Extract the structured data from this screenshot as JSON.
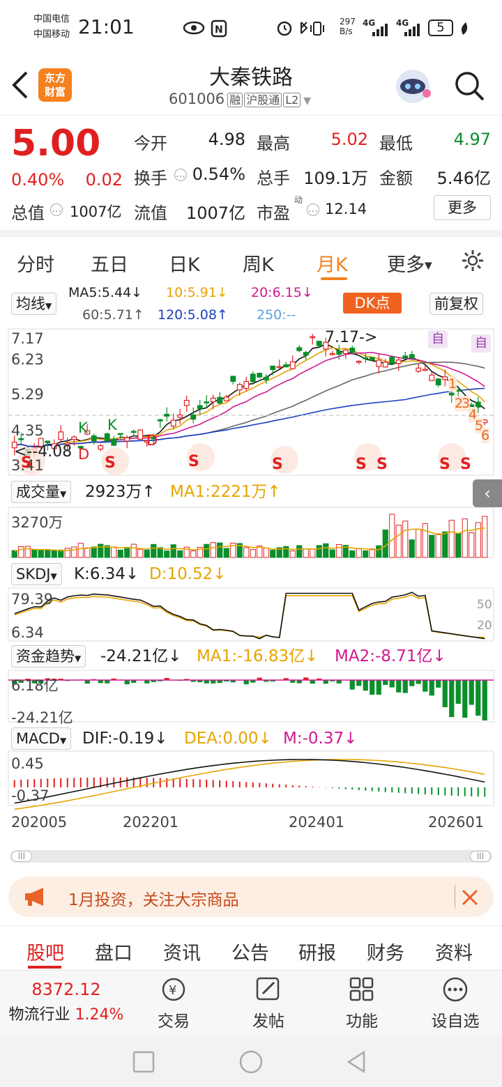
{
  "status": {
    "carrier1": "中国电信",
    "carrier2": "中国移动",
    "time": "21:01",
    "speed_top": "297",
    "speed_bot": "B/s",
    "net1": "4G",
    "net2": "4G",
    "battery": "5"
  },
  "header": {
    "logo_line1": "东方",
    "logo_line2": "财富",
    "title": "大秦铁路",
    "code": "601006",
    "tag1": "融",
    "tag2": "沪股通",
    "tag3": "L2"
  },
  "quote": {
    "price": "5.00",
    "pct": "0.40%",
    "chg": "0.02",
    "open_label": "今开",
    "open": "4.98",
    "high_label": "最高",
    "high": "5.02",
    "low_label": "最低",
    "low": "4.97",
    "turnover_label": "换手",
    "turnover": "0.54%",
    "vol_label": "总手",
    "vol": "109.1万",
    "amt_label": "金额",
    "amt": "5.46亿",
    "mcap_label": "总值",
    "mcap": "1007亿",
    "float_label": "流值",
    "float": "1007亿",
    "pe_label": "市盈",
    "pe_sup": "动",
    "pe": "12.14",
    "more": "更多"
  },
  "tabs": [
    "分时",
    "五日",
    "日K",
    "周K",
    "月K",
    "更多"
  ],
  "ma": {
    "select": "均线",
    "ma5": "MA5:5.44↓",
    "ma10": "10:5.91↓",
    "ma20": "20:6.15↓",
    "ma60": "60:5.71↑",
    "ma120": "120:5.08↑",
    "ma250": "250:--",
    "dk": "DK点",
    "fq": "前复权"
  },
  "kline": {
    "y_top": "7.17",
    "y2": "6.23",
    "y3": "5.29",
    "y4": "4.35",
    "y_bot": "3.41",
    "max_label": "7.17->",
    "min_label": "<--4.08",
    "zi1": "自",
    "zi2": "自",
    "nums": [
      "1",
      "2",
      "3",
      "4",
      "5",
      "6"
    ],
    "signals": [
      "S",
      "S",
      "S",
      "S",
      "S",
      "S",
      "S",
      "S"
    ],
    "k_marks": [
      "K",
      "K"
    ],
    "d_marks": [
      "D",
      "D"
    ]
  },
  "volume": {
    "select": "成交量",
    "val": "2923万↑",
    "ma1": "MA1:2221万↑",
    "scale": "3270万"
  },
  "skdj": {
    "select": "SKDJ",
    "k": "K:6.34↓",
    "d": "D:10.52↓",
    "top": "79.39",
    "bot": "6.34",
    "l50": "50",
    "l20": "20"
  },
  "fund": {
    "select": "资金趋势",
    "val": "-24.21亿↓",
    "ma1": "MA1:-16.83亿↓",
    "ma2": "MA2:-8.71亿↓",
    "top": "6.18亿",
    "bot": "-24.21亿"
  },
  "macd": {
    "select": "MACD",
    "dif": "DIF:-0.19↓",
    "dea": "DEA:0.00↓",
    "m": "M:-0.37↓",
    "top": "0.45",
    "bot": "-0.37"
  },
  "xaxis": [
    "202005",
    "202201",
    "202401",
    "202601"
  ],
  "banner": "1月投资，关注大宗商品",
  "bottom_tabs": [
    "股吧",
    "盘口",
    "资讯",
    "公告",
    "研报",
    "财务",
    "资料"
  ],
  "nav": {
    "index_val": "8372.12",
    "index_name": "物流行业",
    "index_pct": "1.24%",
    "trade": "交易",
    "post": "发帖",
    "func": "功能",
    "watch": "设自选"
  },
  "colors": {
    "up": "#e02020",
    "down": "#0b8f2b",
    "accent": "#f5811f"
  }
}
